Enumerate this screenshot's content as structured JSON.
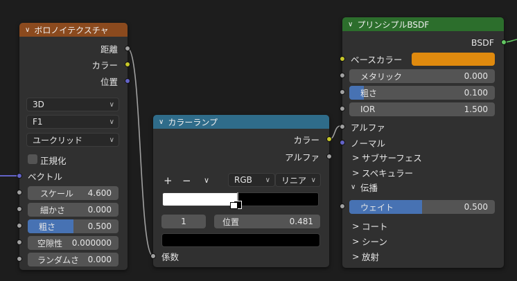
{
  "voronoi": {
    "title": "ボロノイテクスチャ",
    "outputs": {
      "distance": "距離",
      "color": "カラー",
      "position": "位置"
    },
    "dimension": "3D",
    "feature": "F1",
    "metric": "ユークリッド",
    "normalize_label": "正規化",
    "vector_label": "ベクトル",
    "scale": {
      "label": "スケール",
      "value": "4.600"
    },
    "detail": {
      "label": "細かさ",
      "value": "0.000"
    },
    "roughness": {
      "label": "粗さ",
      "value": "0.500",
      "fill": 0.5
    },
    "lacunarity": {
      "label": "空隙性",
      "value": "0.000000"
    },
    "randomness": {
      "label": "ランダムさ",
      "value": "0.000"
    }
  },
  "ramp": {
    "title": "カラーランプ",
    "outputs": {
      "color": "カラー",
      "alpha": "アルファ"
    },
    "add_label": "+",
    "remove_label": "−",
    "menu_label": "∨",
    "color_mode": "RGB",
    "interpolation": "リニア",
    "stop_index": "1",
    "position_label": "位置",
    "position_value": "0.481",
    "input_label": "係数",
    "stop_position": 0.481
  },
  "bsdf": {
    "title": "プリンシプルBSDF",
    "output": "BSDF",
    "base_color_label": "ベースカラー",
    "base_color": "#e08a0e",
    "metallic": {
      "label": "メタリック",
      "value": "0.000"
    },
    "roughness": {
      "label": "粗さ",
      "value": "0.100",
      "fill": 0.1
    },
    "ior": {
      "label": "IOR",
      "value": "1.500"
    },
    "alpha_label": "アルファ",
    "normal_label": "ノーマル",
    "subsurface_label": "サブサーフェス",
    "specular_label": "スペキュラー",
    "transmission_label": "伝播",
    "weight": {
      "label": "ウェイト",
      "value": "0.500",
      "fill": 0.5
    },
    "coat_label": "コート",
    "sheen_label": "シーン",
    "emission_label": "放射"
  },
  "colors": {
    "voronoi_header": "#8b4a1e",
    "ramp_header": "#2f6c8a",
    "bsdf_header": "#2c6e2c",
    "accent": "#4772b3"
  }
}
